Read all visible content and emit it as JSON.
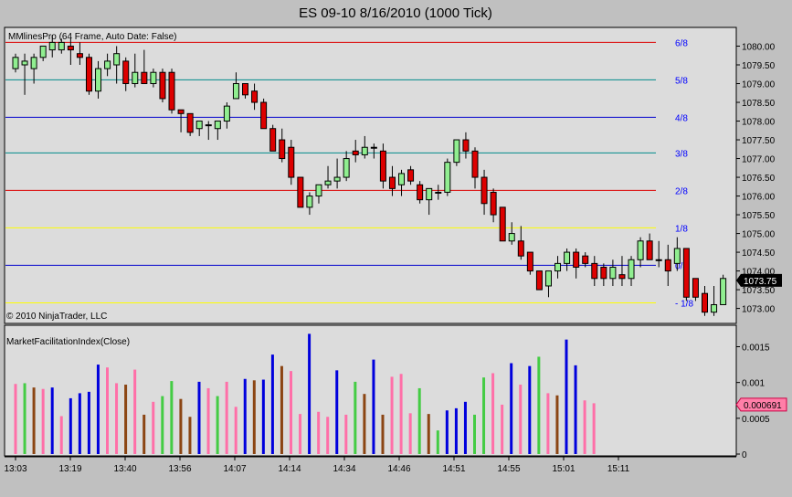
{
  "window_title": "ES 09-10  8/16/2010 (1000 Tick)",
  "chart_data": [
    {
      "type": "candlestick",
      "title": "MMlinesPro (64 Frame, Auto Date: False)",
      "copyright": "© 2010 NinjaTrader, LLC",
      "ylim": [
        1072.6,
        1080.5
      ],
      "y_ticks": [
        "1080.00",
        "1079.50",
        "1079.00",
        "1078.50",
        "1078.00",
        "1077.50",
        "1077.00",
        "1076.50",
        "1076.00",
        "1075.50",
        "1075.00",
        "1074.50",
        "1074.00",
        "1073.50",
        "1073.00"
      ],
      "current_price": "1073.75",
      "x_time_labels": [
        "13:03",
        "13:19",
        "13:40",
        "13:56",
        "14:07",
        "14:14",
        "14:34",
        "14:46",
        "14:51",
        "14:55",
        "15:01",
        "15:11"
      ],
      "levels": [
        {
          "label": "6/8",
          "price": 1080.1,
          "color": "#dd0000"
        },
        {
          "label": "5/8",
          "price": 1079.1,
          "color": "#008b8b"
        },
        {
          "label": "4/8",
          "price": 1078.1,
          "color": "#0000cc"
        },
        {
          "label": "3/8",
          "price": 1077.15,
          "color": "#008b8b"
        },
        {
          "label": "2/8",
          "price": 1076.15,
          "color": "#dd0000"
        },
        {
          "label": "1/8",
          "price": 1075.15,
          "color": "#ffff00"
        },
        {
          "label": "0/8",
          "price": 1074.15,
          "color": "#0000cc"
        },
        {
          "label": "- 1/8",
          "price": 1073.15,
          "color": "#ffff00"
        }
      ],
      "candles": [
        [
          1079.4,
          1079.8,
          1079.3,
          1079.7
        ],
        [
          1079.5,
          1079.8,
          1078.7,
          1079.6
        ],
        [
          1079.4,
          1079.8,
          1079.0,
          1079.7
        ],
        [
          1079.7,
          1080.0,
          1079.6,
          1080.0
        ],
        [
          1079.9,
          1080.3,
          1079.7,
          1080.1
        ],
        [
          1079.9,
          1080.2,
          1079.8,
          1080.1
        ],
        [
          1080.0,
          1080.2,
          1079.5,
          1079.9
        ],
        [
          1079.8,
          1080.1,
          1079.5,
          1079.7
        ],
        [
          1079.7,
          1079.8,
          1078.7,
          1078.8
        ],
        [
          1078.8,
          1079.6,
          1078.6,
          1079.4
        ],
        [
          1079.4,
          1079.8,
          1079.2,
          1079.6
        ],
        [
          1079.5,
          1080.0,
          1079.0,
          1079.8
        ],
        [
          1079.6,
          1079.7,
          1078.8,
          1079.0
        ],
        [
          1079.0,
          1079.8,
          1078.9,
          1079.3
        ],
        [
          1079.3,
          1079.9,
          1079.0,
          1079.0
        ],
        [
          1079.0,
          1079.4,
          1078.9,
          1079.3
        ],
        [
          1079.3,
          1079.4,
          1078.5,
          1078.6
        ],
        [
          1079.3,
          1079.4,
          1078.2,
          1078.3
        ],
        [
          1078.3,
          1078.3,
          1077.7,
          1078.2
        ],
        [
          1078.2,
          1078.2,
          1077.6,
          1077.7
        ],
        [
          1077.8,
          1078.0,
          1077.6,
          1078.0
        ],
        [
          1077.9,
          1078.0,
          1077.5,
          1077.9
        ],
        [
          1077.8,
          1078.0,
          1077.5,
          1078.0
        ],
        [
          1078.0,
          1078.5,
          1077.8,
          1078.4
        ],
        [
          1078.6,
          1079.3,
          1078.6,
          1079.0
        ],
        [
          1079.0,
          1079.0,
          1078.6,
          1078.7
        ],
        [
          1078.8,
          1079.0,
          1078.3,
          1078.5
        ],
        [
          1078.5,
          1078.6,
          1077.8,
          1077.8
        ],
        [
          1077.8,
          1077.9,
          1077.2,
          1077.2
        ],
        [
          1077.5,
          1077.8,
          1076.9,
          1077.0
        ],
        [
          1077.3,
          1077.5,
          1076.3,
          1076.5
        ],
        [
          1076.5,
          1076.5,
          1075.7,
          1075.7
        ],
        [
          1075.7,
          1076.1,
          1075.5,
          1076.0
        ],
        [
          1076.0,
          1076.3,
          1075.8,
          1076.3
        ],
        [
          1076.3,
          1076.8,
          1076.2,
          1076.4
        ],
        [
          1076.4,
          1077.0,
          1076.2,
          1076.5
        ],
        [
          1076.5,
          1077.2,
          1076.4,
          1077.0
        ],
        [
          1077.2,
          1077.5,
          1076.9,
          1077.1
        ],
        [
          1077.1,
          1077.6,
          1077.0,
          1077.3
        ],
        [
          1077.3,
          1077.4,
          1077.0,
          1077.3
        ],
        [
          1077.2,
          1077.4,
          1076.2,
          1076.4
        ],
        [
          1076.5,
          1076.8,
          1076.0,
          1076.2
        ],
        [
          1076.3,
          1076.7,
          1076.0,
          1076.6
        ],
        [
          1076.7,
          1076.8,
          1076.3,
          1076.4
        ],
        [
          1076.3,
          1076.4,
          1075.8,
          1075.9
        ],
        [
          1075.9,
          1076.1,
          1075.5,
          1076.2
        ],
        [
          1076.1,
          1076.3,
          1075.9,
          1076.1
        ],
        [
          1076.1,
          1077.0,
          1076.0,
          1076.9
        ],
        [
          1076.9,
          1077.5,
          1076.8,
          1077.5
        ],
        [
          1077.5,
          1077.7,
          1077.0,
          1077.2
        ],
        [
          1077.2,
          1077.3,
          1076.2,
          1076.5
        ],
        [
          1076.5,
          1076.7,
          1075.5,
          1075.8
        ],
        [
          1076.1,
          1076.2,
          1075.3,
          1075.5
        ],
        [
          1075.7,
          1075.7,
          1074.8,
          1074.8
        ],
        [
          1074.8,
          1075.3,
          1074.7,
          1075.0
        ],
        [
          1074.8,
          1075.2,
          1074.3,
          1074.4
        ],
        [
          1074.5,
          1074.5,
          1073.9,
          1074.0
        ],
        [
          1074.0,
          1074.0,
          1073.5,
          1073.5
        ],
        [
          1073.6,
          1074.0,
          1073.3,
          1074.0
        ],
        [
          1074.0,
          1074.4,
          1073.8,
          1074.2
        ],
        [
          1074.2,
          1074.6,
          1074.0,
          1074.5
        ],
        [
          1074.5,
          1074.6,
          1073.8,
          1074.1
        ],
        [
          1074.4,
          1074.5,
          1074.1,
          1074.2
        ],
        [
          1074.2,
          1074.4,
          1073.6,
          1073.8
        ],
        [
          1074.1,
          1074.2,
          1073.6,
          1073.8
        ],
        [
          1073.8,
          1074.3,
          1073.6,
          1074.1
        ],
        [
          1073.9,
          1074.4,
          1073.6,
          1073.8
        ],
        [
          1073.8,
          1074.4,
          1073.6,
          1074.3
        ],
        [
          1074.3,
          1074.9,
          1074.1,
          1074.8
        ],
        [
          1074.8,
          1075.0,
          1074.3,
          1074.3
        ],
        [
          1074.3,
          1074.8,
          1074.1,
          1074.3
        ],
        [
          1074.3,
          1074.7,
          1073.6,
          1074.0
        ],
        [
          1074.2,
          1074.9,
          1074.0,
          1074.6
        ],
        [
          1074.6,
          1074.6,
          1073.2,
          1073.3
        ],
        [
          1073.8,
          1073.8,
          1073.2,
          1073.3
        ],
        [
          1073.4,
          1073.6,
          1072.8,
          1072.9
        ],
        [
          1072.9,
          1073.6,
          1072.8,
          1073.1
        ],
        [
          1073.1,
          1073.9,
          1073.1,
          1073.8
        ]
      ]
    },
    {
      "type": "bar",
      "title": "MarketFacilitationIndex(Close)",
      "ylim": [
        0,
        0.0018
      ],
      "y_ticks": [
        "0.0015",
        "0.001",
        "0.0005",
        "0"
      ],
      "current_value": "0.000691",
      "colors": {
        "B": "#0000dd",
        "G": "#44cc44",
        "P": "#ff6fa8",
        "N": "#8b4513"
      },
      "bars": [
        [
          0.00098,
          "P"
        ],
        [
          0.00099,
          "G"
        ],
        [
          0.00093,
          "N"
        ],
        [
          0.00091,
          "P"
        ],
        [
          0.00093,
          "B"
        ],
        [
          0.00053,
          "P"
        ],
        [
          0.00078,
          "B"
        ],
        [
          0.00085,
          "B"
        ],
        [
          0.00087,
          "B"
        ],
        [
          0.00125,
          "B"
        ],
        [
          0.00121,
          "P"
        ],
        [
          0.00099,
          "P"
        ],
        [
          0.00097,
          "N"
        ],
        [
          0.00118,
          "P"
        ],
        [
          0.00055,
          "N"
        ],
        [
          0.00073,
          "P"
        ],
        [
          0.00081,
          "G"
        ],
        [
          0.00102,
          "G"
        ],
        [
          0.00077,
          "N"
        ],
        [
          0.00052,
          "N"
        ],
        [
          0.00101,
          "B"
        ],
        [
          0.00092,
          "P"
        ],
        [
          0.00081,
          "G"
        ],
        [
          0.00101,
          "P"
        ],
        [
          0.00066,
          "P"
        ],
        [
          0.00105,
          "B"
        ],
        [
          0.00103,
          "N"
        ],
        [
          0.00104,
          "B"
        ],
        [
          0.00139,
          "B"
        ],
        [
          0.00123,
          "N"
        ],
        [
          0.00116,
          "P"
        ],
        [
          0.00056,
          "P"
        ],
        [
          0.00168,
          "B"
        ],
        [
          0.00059,
          "P"
        ],
        [
          0.00052,
          "P"
        ],
        [
          0.00117,
          "B"
        ],
        [
          0.00055,
          "P"
        ],
        [
          0.00101,
          "G"
        ],
        [
          0.00084,
          "N"
        ],
        [
          0.00132,
          "B"
        ],
        [
          0.00055,
          "N"
        ],
        [
          0.00108,
          "P"
        ],
        [
          0.00112,
          "P"
        ],
        [
          0.00057,
          "P"
        ],
        [
          0.00092,
          "G"
        ],
        [
          0.00056,
          "N"
        ],
        [
          0.00033,
          "G"
        ],
        [
          0.00061,
          "B"
        ],
        [
          0.00064,
          "B"
        ],
        [
          0.00073,
          "B"
        ],
        [
          0.00055,
          "G"
        ],
        [
          0.00107,
          "G"
        ],
        [
          0.00113,
          "P"
        ],
        [
          0.00069,
          "P"
        ],
        [
          0.00127,
          "B"
        ],
        [
          0.00097,
          "P"
        ],
        [
          0.00123,
          "B"
        ],
        [
          0.00136,
          "G"
        ],
        [
          0.00085,
          "P"
        ],
        [
          0.00082,
          "N"
        ],
        [
          0.0016,
          "B"
        ],
        [
          0.00124,
          "B"
        ],
        [
          0.00075,
          "P"
        ],
        [
          0.00071,
          "P"
        ]
      ]
    }
  ]
}
